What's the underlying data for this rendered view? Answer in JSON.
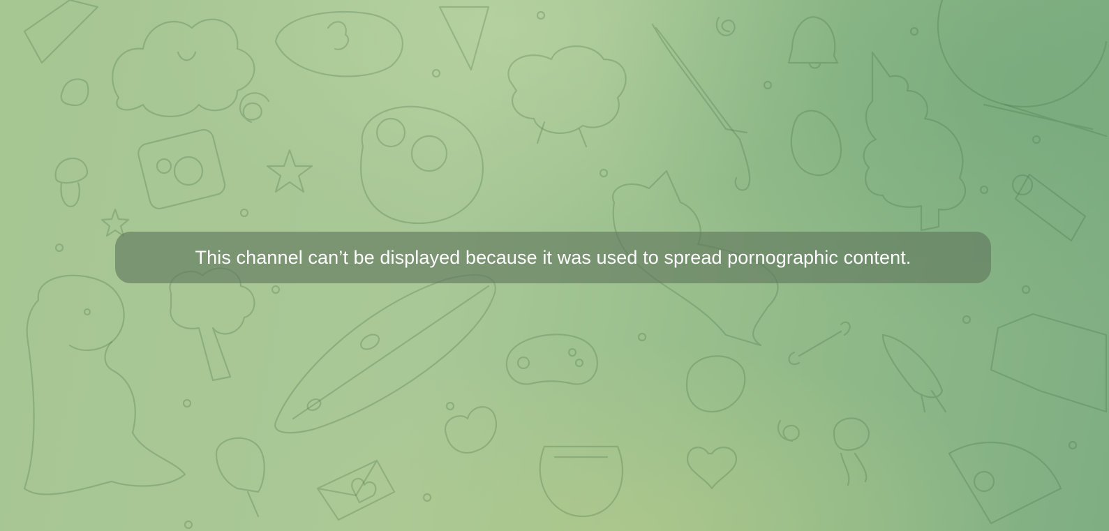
{
  "chat": {
    "notice": "This channel can’t be displayed because it was used to spread pornographic content."
  },
  "background": {
    "pattern": "doodle-wallpaper",
    "colors": [
      "#a6c692",
      "#93bb89",
      "#7fae83"
    ]
  }
}
